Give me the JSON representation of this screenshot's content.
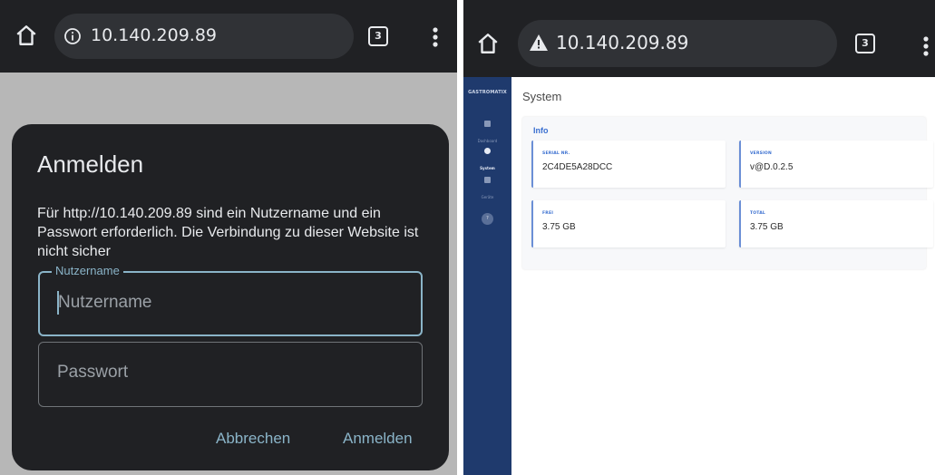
{
  "login_view": {
    "url": "10.140.209.89",
    "tab_count": "3",
    "dialog": {
      "title": "Anmelden",
      "message": "Für http://10.140.209.89 sind ein Nutzername und ein Passwort erforderlich. Die Verbindung zu dieser Website ist nicht sicher",
      "username_legend": "Nutzername",
      "username_placeholder": "Nutzername",
      "password_placeholder": "Passwort",
      "cancel_label": "Abbrechen",
      "submit_label": "Anmelden"
    }
  },
  "system_view": {
    "url": "10.140.209.89",
    "tab_count": "3",
    "sidebar": {
      "brand": "GASTROMATIX",
      "items": [
        {
          "label": "Dashboard",
          "active": false
        },
        {
          "label": "System",
          "active": true
        },
        {
          "label": "Geräte",
          "active": false
        }
      ],
      "badge": "?"
    },
    "page_title": "System",
    "info_card": {
      "title": "Info",
      "tiles": [
        {
          "label": "SERIAL NR.",
          "value": "2C4DE5A28DCC"
        },
        {
          "label": "VERSION",
          "value": "v@D.0.2.5"
        },
        {
          "label": "FREI",
          "value": "3.75 GB"
        },
        {
          "label": "TOTAL",
          "value": "3.75 GB"
        }
      ]
    },
    "colors": {
      "sidebar_bg": "#1f3a6d",
      "accent": "#3a6fd0",
      "browser_bar": "#202124"
    }
  },
  "icons": [
    "home-icon",
    "info-icon",
    "warning-icon",
    "tab-switcher-icon",
    "more-vert-icon"
  ]
}
